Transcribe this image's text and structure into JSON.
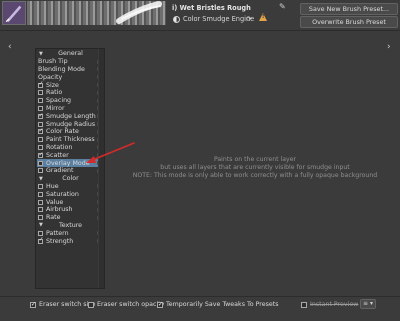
{
  "header": {
    "preset_name": "i) Wet Bristles Rough",
    "engine_label": "Color Smudge Engine",
    "save_new_label": "Save New Brush Preset...",
    "overwrite_label": "Overwrite Brush Preset"
  },
  "panel": {
    "rows": [
      {
        "type": "header",
        "label": "General"
      },
      {
        "type": "plain",
        "label": "Brush Tip"
      },
      {
        "type": "plain",
        "label": "Blending Mode"
      },
      {
        "type": "plain",
        "label": "Opacity"
      },
      {
        "type": "check",
        "label": "Size",
        "checked": true
      },
      {
        "type": "check",
        "label": "Ratio",
        "checked": false
      },
      {
        "type": "check",
        "label": "Spacing",
        "checked": false
      },
      {
        "type": "check",
        "label": "Mirror",
        "checked": false
      },
      {
        "type": "check",
        "label": "Smudge Length",
        "checked": true
      },
      {
        "type": "check",
        "label": "Smudge Radius",
        "checked": false
      },
      {
        "type": "check",
        "label": "Color Rate",
        "checked": true
      },
      {
        "type": "check",
        "label": "Paint Thickness",
        "checked": false
      },
      {
        "type": "check",
        "label": "Rotation",
        "checked": false
      },
      {
        "type": "check",
        "label": "Scatter",
        "checked": true
      },
      {
        "type": "check",
        "label": "Overlay Mode",
        "checked": false,
        "selected": true
      },
      {
        "type": "check",
        "label": "Gradient",
        "checked": false
      },
      {
        "type": "header",
        "label": "Color"
      },
      {
        "type": "check",
        "label": "Hue",
        "checked": false
      },
      {
        "type": "check",
        "label": "Saturation",
        "checked": false
      },
      {
        "type": "check",
        "label": "Value",
        "checked": false
      },
      {
        "type": "check",
        "label": "Airbrush",
        "checked": false
      },
      {
        "type": "check",
        "label": "Rate",
        "checked": false
      },
      {
        "type": "header",
        "label": "Texture"
      },
      {
        "type": "check",
        "label": "Pattern",
        "checked": false
      },
      {
        "type": "check",
        "label": "Strength",
        "checked": true
      }
    ]
  },
  "description": {
    "line1": "Paints on the current layer",
    "line2": "but uses all layers that are currently visible for smudge input",
    "line3": "NOTE: This mode is only able to work correctly with a fully opaque background"
  },
  "bottom": {
    "eraser_switch_size": "Eraser switch size",
    "eraser_switch_opacity": "Eraser switch opacity",
    "temp_save_tweaks": "Temporarily Save Tweaks To Presets",
    "instant_preview": "Instant Preview"
  },
  "colors": {
    "selection": "#5b7fa0",
    "annotation_arrow": "#d42a2a",
    "warning": "#e4a24a"
  },
  "icons": {
    "edit": "pencil-icon",
    "reload": "reload-icon",
    "warning": "warning-icon",
    "nav_prev": "chevron-left-icon",
    "nav_next": "chevron-right-icon",
    "menu": "hamburger-menu-icon"
  }
}
